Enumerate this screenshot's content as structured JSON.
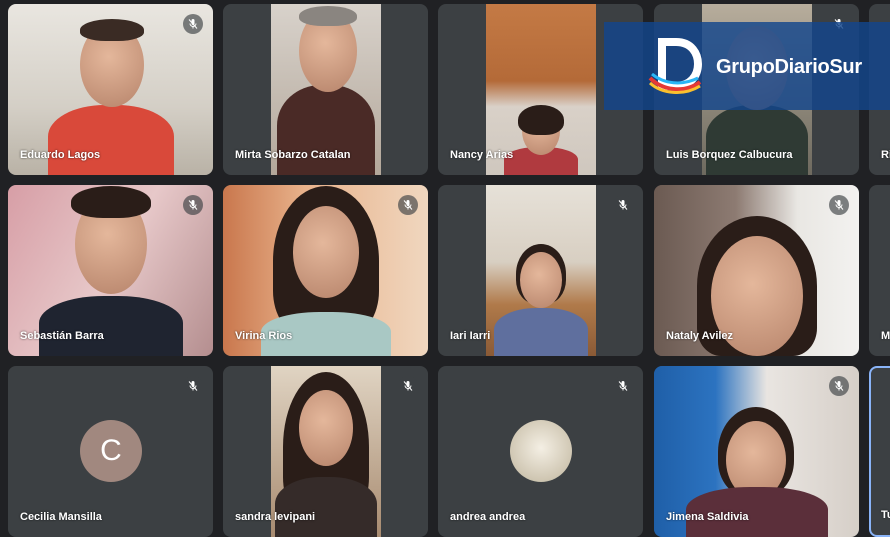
{
  "participants": [
    {
      "name": "Eduardo Lagos",
      "muted": true
    },
    {
      "name": "Mirta Sobarzo Catalan",
      "muted": false
    },
    {
      "name": "Nancy Arias",
      "muted": false
    },
    {
      "name": "Luis Borquez Calbucura",
      "muted": true
    },
    {
      "name": "Ri",
      "muted": true
    },
    {
      "name": "Sebastián Barra",
      "muted": true
    },
    {
      "name": "Virina Rios",
      "muted": true
    },
    {
      "name": "Iari Iarri",
      "muted": true
    },
    {
      "name": "Nataly Avilez",
      "muted": true
    },
    {
      "name": "M",
      "muted": false
    },
    {
      "name": "Cecilia Mansilla",
      "muted": true,
      "avatar_letter": "C"
    },
    {
      "name": "sandra levipani",
      "muted": true
    },
    {
      "name": "andrea andrea",
      "muted": true
    },
    {
      "name": "Jimena Saldivia",
      "muted": true
    },
    {
      "name": "Tu",
      "muted": false
    }
  ],
  "watermark": {
    "brand": "GrupoDiarioSur",
    "mark_letter": "D"
  },
  "colors": {
    "background": "#202124",
    "tile": "#3c4043",
    "brand_blue": "#12468c",
    "selected_border": "#8ab4f8"
  },
  "icons": {
    "mute": "mic-off-icon"
  }
}
